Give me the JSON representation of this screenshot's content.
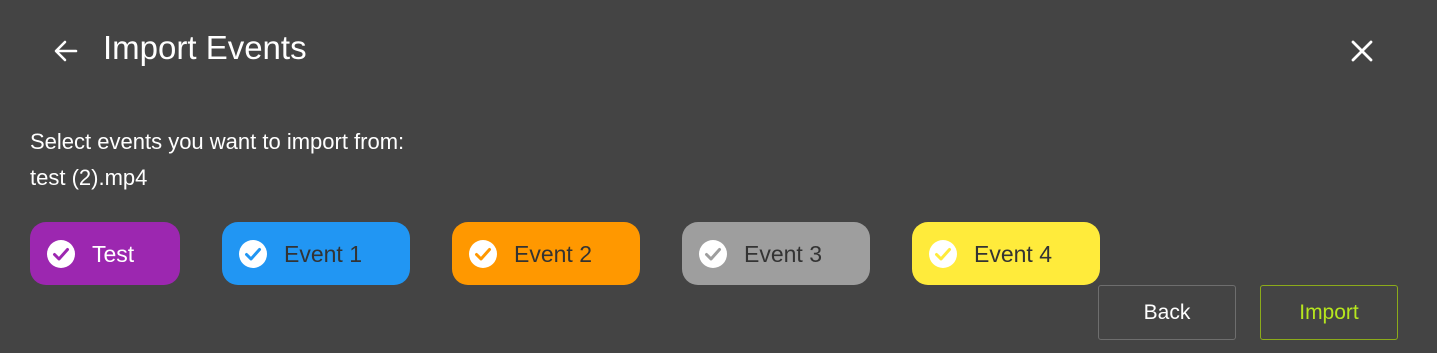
{
  "header": {
    "title": "Import Events",
    "back_icon": "arrow-left-icon",
    "close_icon": "close-icon"
  },
  "body": {
    "prompt": "Select events you want to import from:",
    "filename": "test (2).mp4"
  },
  "events": [
    {
      "label": "Test",
      "bg": "#9c27b0",
      "text_color": "#ffffff",
      "check_color": "#9c27b0",
      "checked": true
    },
    {
      "label": "Event 1",
      "bg": "#2196f3",
      "text_color": "#333333",
      "check_color": "#2196f3",
      "checked": true
    },
    {
      "label": "Event 2",
      "bg": "#ff9800",
      "text_color": "#333333",
      "check_color": "#ff9800",
      "checked": true
    },
    {
      "label": "Event 3",
      "bg": "#9e9e9e",
      "text_color": "#333333",
      "check_color": "#9e9e9e",
      "checked": true
    },
    {
      "label": "Event 4",
      "bg": "#ffeb3b",
      "text_color": "#333333",
      "check_color": "#ffeb3b",
      "checked": true
    }
  ],
  "footer": {
    "back_label": "Back",
    "import_label": "Import",
    "import_color": "#b6e61e"
  }
}
